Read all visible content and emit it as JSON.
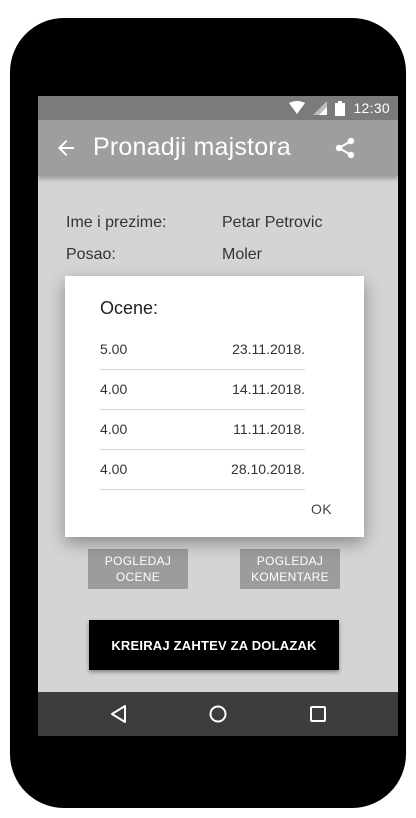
{
  "status_bar": {
    "time": "12:30"
  },
  "app_bar": {
    "title": "Pronadji majstora"
  },
  "profile": {
    "name_label": "Ime i prezime:",
    "name_value": "Petar Petrovic",
    "job_label": "Posao:",
    "job_value": "Moler"
  },
  "dialog": {
    "title": "Ocene:",
    "ratings": [
      {
        "score": "5.00",
        "date": "23.11.2018."
      },
      {
        "score": "4.00",
        "date": "14.11.2018."
      },
      {
        "score": "4.00",
        "date": "11.11.2018."
      },
      {
        "score": "4.00",
        "date": "28.10.2018."
      }
    ],
    "ok_label": "OK"
  },
  "buttons": {
    "view_ratings_line1": "POGLEDAJ",
    "view_ratings_line2": "OCENE",
    "view_comments_line1": "POGLEDAJ",
    "view_comments_line2": "KOMENTARE",
    "create_request": "KREIRAJ ZAHTEV ZA DOLAZAK"
  },
  "icons": {
    "wifi": "wifi-icon",
    "signal": "signal-icon",
    "battery": "battery-icon",
    "back": "arrow-back-icon",
    "share": "share-icon",
    "nav_back": "triangle-back-icon",
    "nav_home": "circle-home-icon",
    "nav_recents": "square-recents-icon"
  },
  "colors": {
    "app_bar": "#9e9e9e",
    "status_bar": "#7b7b7b",
    "screen_bg": "#d4d4d4",
    "cta_bg": "#000000",
    "nav_bar": "#3d3d3d"
  }
}
